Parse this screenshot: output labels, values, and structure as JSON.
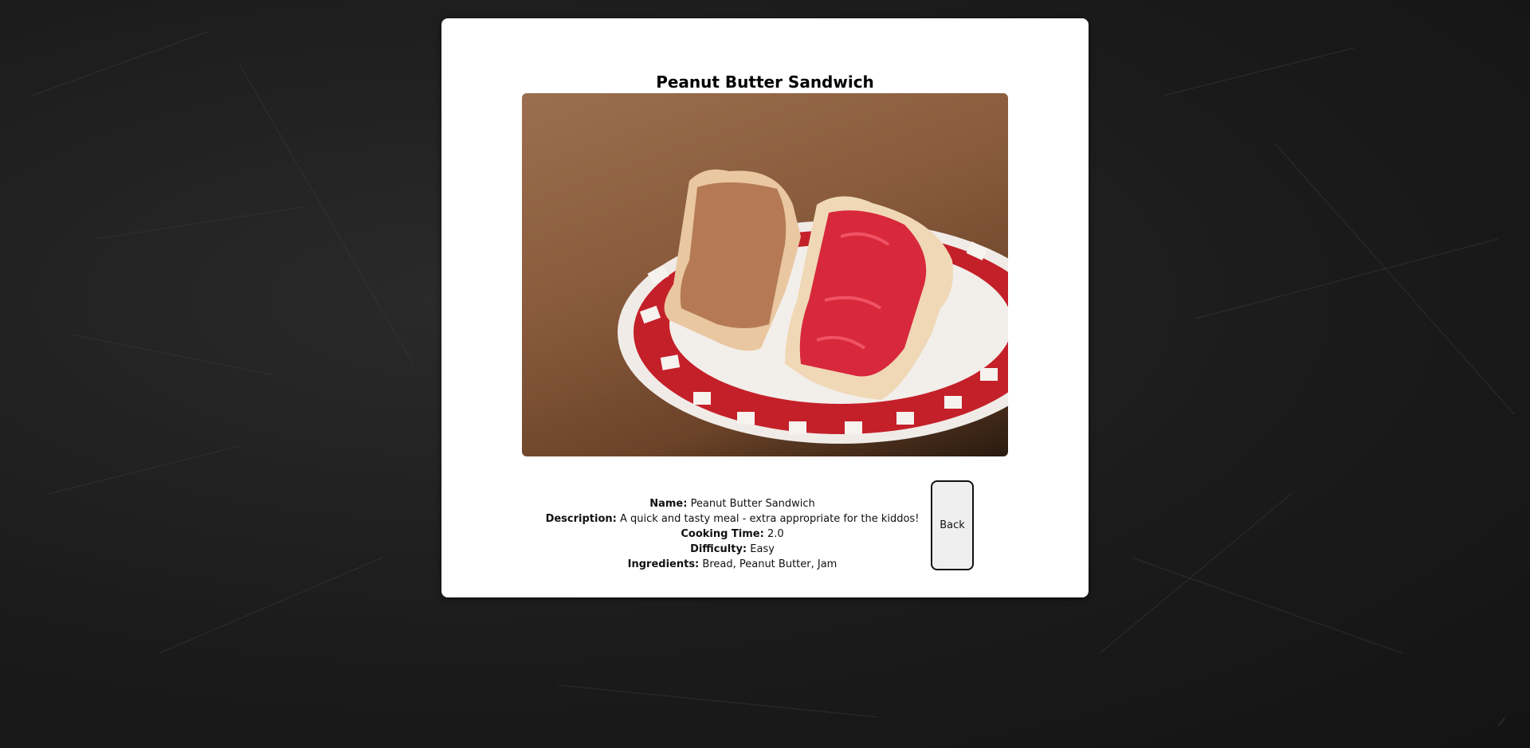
{
  "recipe": {
    "title": "Peanut Butter Sandwich",
    "image_alt": "Peanut butter and jam toast on a red checkered plate",
    "fields": {
      "name_label": "Name:",
      "name_value": "Peanut Butter Sandwich",
      "description_label": "Description:",
      "description_value": "A quick and tasty meal - extra appropriate for the kiddos!",
      "cooking_time_label": "Cooking Time:",
      "cooking_time_value": "2.0",
      "difficulty_label": "Difficulty:",
      "difficulty_value": "Easy",
      "ingredients_label": "Ingredients:",
      "ingredients_value": "Bread, Peanut Butter, Jam"
    }
  },
  "actions": {
    "back_label": "Back"
  },
  "colors": {
    "background": "#1c1c1c",
    "card": "#ffffff",
    "button_bg": "#efefef",
    "plate_red": "#c4202a",
    "jam": "#d8283c",
    "peanut_butter": "#b57a55"
  }
}
